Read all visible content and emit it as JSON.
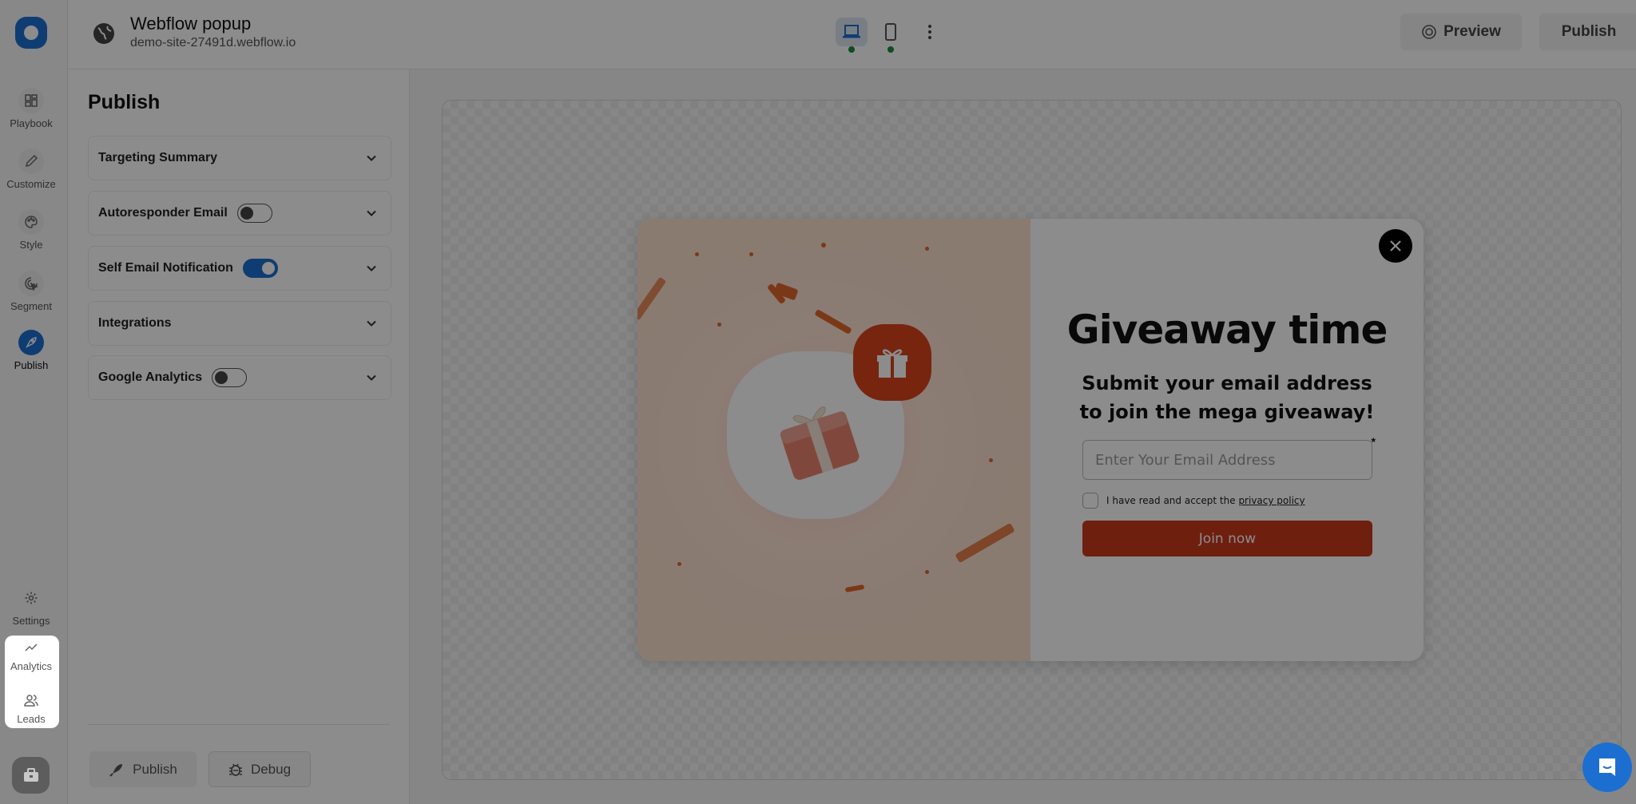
{
  "app": {
    "title": "Webflow popup",
    "site_url": "demo-site-27491d.webflow.io"
  },
  "rail": {
    "items": [
      {
        "label": "Playbook",
        "icon": "grid-icon"
      },
      {
        "label": "Customize",
        "icon": "pencil-icon"
      },
      {
        "label": "Style",
        "icon": "palette-icon"
      },
      {
        "label": "Segment",
        "icon": "target-cursor-icon"
      },
      {
        "label": "Publish",
        "icon": "rocket-icon",
        "active": true
      }
    ],
    "bottom_items": [
      {
        "label": "Settings",
        "icon": "gear-icon"
      },
      {
        "label": "Analytics",
        "icon": "trend-line-icon"
      },
      {
        "label": "Leads",
        "icon": "users-icon"
      }
    ]
  },
  "topbar": {
    "devices": [
      {
        "name": "desktop",
        "active": true,
        "status": "green"
      },
      {
        "name": "mobile",
        "active": false,
        "status": "green"
      }
    ],
    "preview_label": "Preview",
    "publish_label": "Publish"
  },
  "panel": {
    "title": "Publish",
    "sections": [
      {
        "label": "Targeting Summary",
        "has_toggle": false
      },
      {
        "label": "Autoresponder Email",
        "has_toggle": true,
        "toggle_on": false
      },
      {
        "label": "Self Email Notification",
        "has_toggle": true,
        "toggle_on": true
      },
      {
        "label": "Integrations",
        "has_toggle": false
      },
      {
        "label": "Google Analytics",
        "has_toggle": true,
        "toggle_on": false
      }
    ],
    "publish_button": "Publish",
    "debug_button": "Debug"
  },
  "popup": {
    "headline": "Giveaway time",
    "subheadline": "Submit your email address to join the mega giveaway!",
    "email_placeholder": "Enter Your Email Address",
    "email_value": "",
    "required_marker": "*",
    "consent_text": "I have read and accept the",
    "consent_link": "privacy policy",
    "consent_checked": false,
    "cta_label": "Join now"
  },
  "colors": {
    "brand": "#1c6fd1",
    "cta": "#c8391b",
    "status_ok": "#1a8a3c"
  }
}
